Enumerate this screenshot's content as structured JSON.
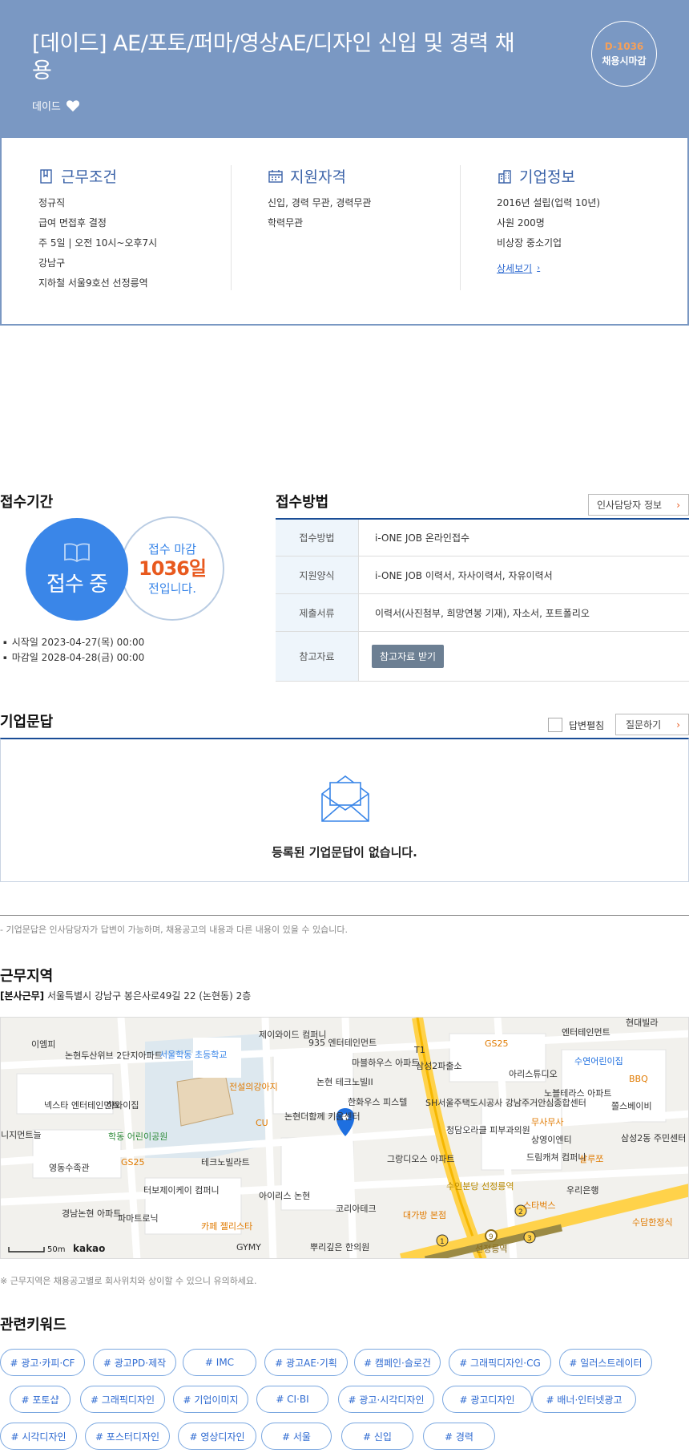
{
  "header": {
    "title": "[데이드] AE/포토/퍼마/영상AE/디자인 신입 및 경력 채용",
    "company": "데이드",
    "dday": "D-1036",
    "status": "채용시마감"
  },
  "info": {
    "work": {
      "title": "근무조건",
      "lines": [
        "정규직",
        "급여 면접후 결정",
        "주 5일 | 오전 10시~오후7시",
        "강남구",
        "지하철 서울9호선 선정릉역"
      ]
    },
    "qualification": {
      "title": "지원자격",
      "lines": [
        "신입, 경력 무관, 경력무관",
        "학력무관"
      ]
    },
    "company": {
      "title": "기업정보",
      "lines": [
        "2016년 설립(업력 10년)",
        "사원 200명",
        "비상장 중소기업"
      ],
      "detail_link": "상세보기"
    }
  },
  "reception": {
    "title": "접수기간",
    "status": "접수 중",
    "deadline_line1": "접수 마감",
    "deadline_days": "1036일",
    "deadline_line3": "전입니다.",
    "start": "시작일 2023-04-27(목) 00:00",
    "end": "마감일 2028-04-28(금) 00:00"
  },
  "method": {
    "title": "접수방법",
    "hr_button": "인사담당자 정보",
    "rows": [
      {
        "key": "접수방법",
        "value": "i-ONE JOB 온라인접수"
      },
      {
        "key": "지원양식",
        "value": "i-ONE JOB 이력서, 자사이력서, 자유이력서"
      },
      {
        "key": "제출서류",
        "value": "이력서(사진첨부, 희망연봉 기재), 자소서, 포트폴리오"
      },
      {
        "key": "참고자료",
        "value": "참고자료 받기"
      }
    ]
  },
  "qna": {
    "title": "기업문답",
    "toggle_label": "답변펼침",
    "ask_button": "질문하기",
    "empty": "등록된 기업문답이 없습니다.",
    "note": "- 기업문답은 인사담당자가 답변이 가능하며, 채용공고의 내용과 다른 내용이 있을 수 있습니다."
  },
  "region": {
    "title": "근무지역",
    "office_label": "[본사근무]",
    "address": "서울특별시 강남구 봉은사로49길 22 (논현동) 2층",
    "note": "※ 근무지역은 채용공고별로 회사위치와 상이할 수 있으니 유의하세요.",
    "map": {
      "labels": {
        "l1": "이엠피",
        "l2": "논현두산위브 2단지아파트",
        "l3": "서울학동 초등학교",
        "l4": "제이와이드 컴퍼니",
        "l5": "935 엔터테인먼트",
        "l6": "마블하우스 아파트",
        "l7": "삼성2파출소",
        "l8": "GS25",
        "l9": "아리스튜디오",
        "l10": "수연어린이집",
        "l11": "BBQ",
        "l12": "넥스타 엔터테인먼트",
        "l13": "하와이집",
        "l14": "전설의강아지",
        "l15": "논현 테크노빌II",
        "l16": "한화우스 피스텔",
        "l17": "SH서울주택도시공사 강남주거안심종합센터",
        "l18": "노블테라스 아파트",
        "l19": "쫄스베이비",
        "l20": "니지먼트늘",
        "l21": "학동 어린이공원",
        "l22": "CU",
        "l23": "논현더함께 키움센터",
        "l24": "무사무사",
        "l25": "청담오라클 피부과의원",
        "l26": "상영이엔티",
        "l27": "삼성2동 주민센터",
        "l28": "영동수족관",
        "l29": "GS25",
        "l30": "테크노빌라트",
        "l31": "그랑디오스 아파트",
        "l32": "드림캐쳐 컴퍼니",
        "l33": "살루쪼",
        "l34": "터보제이케이 컴퍼니",
        "l35": "아이리스 논현",
        "l36": "수인분당 선정릉역",
        "l37": "우리은행",
        "l38": "경남논현 아파트",
        "l39": "파마트로닉",
        "l40": "카페 젤리스타",
        "l41": "코리아테크",
        "l42": "대가방 본점",
        "l43": "스타벅스",
        "l44": "수담한정식",
        "l45": "GYMY",
        "l46": "뿌리깊은 한의원",
        "l47": "선정릉역",
        "l48": "현대빌라",
        "l49": "엔터테인먼트",
        "l50": "T1",
        "scale": "50m",
        "brand": "kakao"
      }
    }
  },
  "keywords": {
    "title": "관련키워드",
    "items": [
      "# 광고·카피·CF",
      "# 광고PD·제작",
      "# IMC",
      "# 광고AE·기획",
      "# 캠페인·슬로건",
      "# 그래픽디자인·CG",
      "# 일러스트레이터",
      "# 포토샵",
      "# 그래픽디자인",
      "# 기업이미지",
      "# CI·BI",
      "# 광고·시각디자인",
      "# 광고디자인",
      "# 배너·인터넷광고",
      "# 시각디자인",
      "# 포스터디자인",
      "# 영상디자인",
      "# 서울",
      "# 신입",
      "# 경력"
    ]
  },
  "colors": {
    "header_bg": "#7a98c3",
    "primary_blue": "#3a86e8",
    "accent_orange": "#e8591e",
    "navy": "#1a4d96"
  }
}
